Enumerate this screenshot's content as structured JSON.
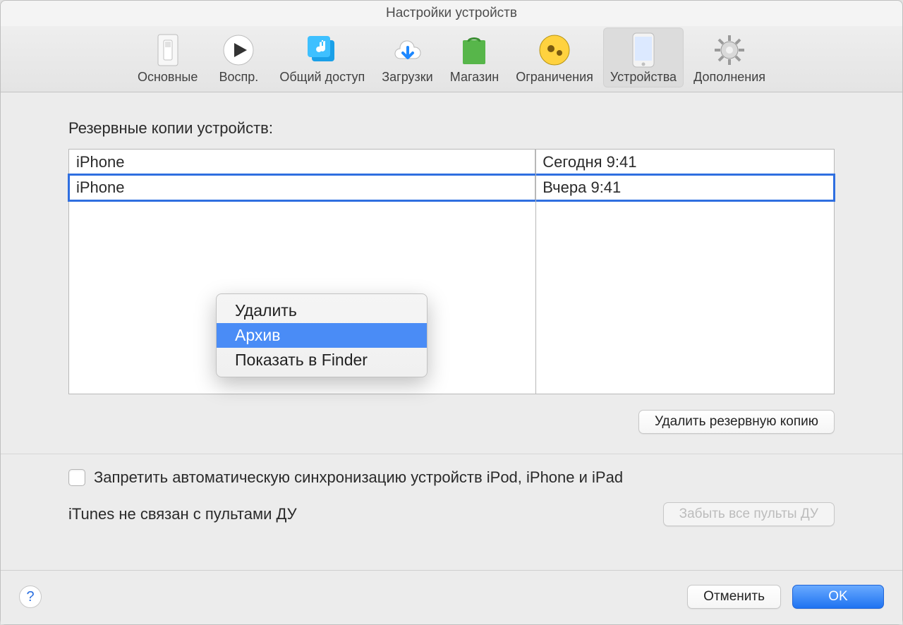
{
  "window": {
    "title": "Настройки устройств"
  },
  "tabs": {
    "general": {
      "label": "Основные"
    },
    "playback": {
      "label": "Воспр."
    },
    "sharing": {
      "label": "Общий доступ"
    },
    "downloads": {
      "label": "Загрузки"
    },
    "store": {
      "label": "Магазин"
    },
    "restrictions": {
      "label": "Ограничения"
    },
    "devices": {
      "label": "Устройства"
    },
    "advanced": {
      "label": "Дополнения"
    }
  },
  "backups": {
    "heading": "Резервные копии устройств:",
    "rows": [
      {
        "name": "iPhone",
        "date": "Сегодня 9:41"
      },
      {
        "name": "iPhone",
        "date": "Вчера 9:41"
      }
    ],
    "deleteBtn": "Удалить резервную копию"
  },
  "contextMenu": {
    "delete": "Удалить",
    "archive": "Архив",
    "reveal": "Показать в Finder"
  },
  "syncCheckbox": {
    "label": "Запретить автоматическую синхронизацию устройств iPod, iPhone и iPad"
  },
  "remotes": {
    "status": "iTunes не связан с пультами ДУ",
    "forgetBtn": "Забыть все пульты ДУ"
  },
  "footer": {
    "cancel": "Отменить",
    "ok": "OK"
  }
}
